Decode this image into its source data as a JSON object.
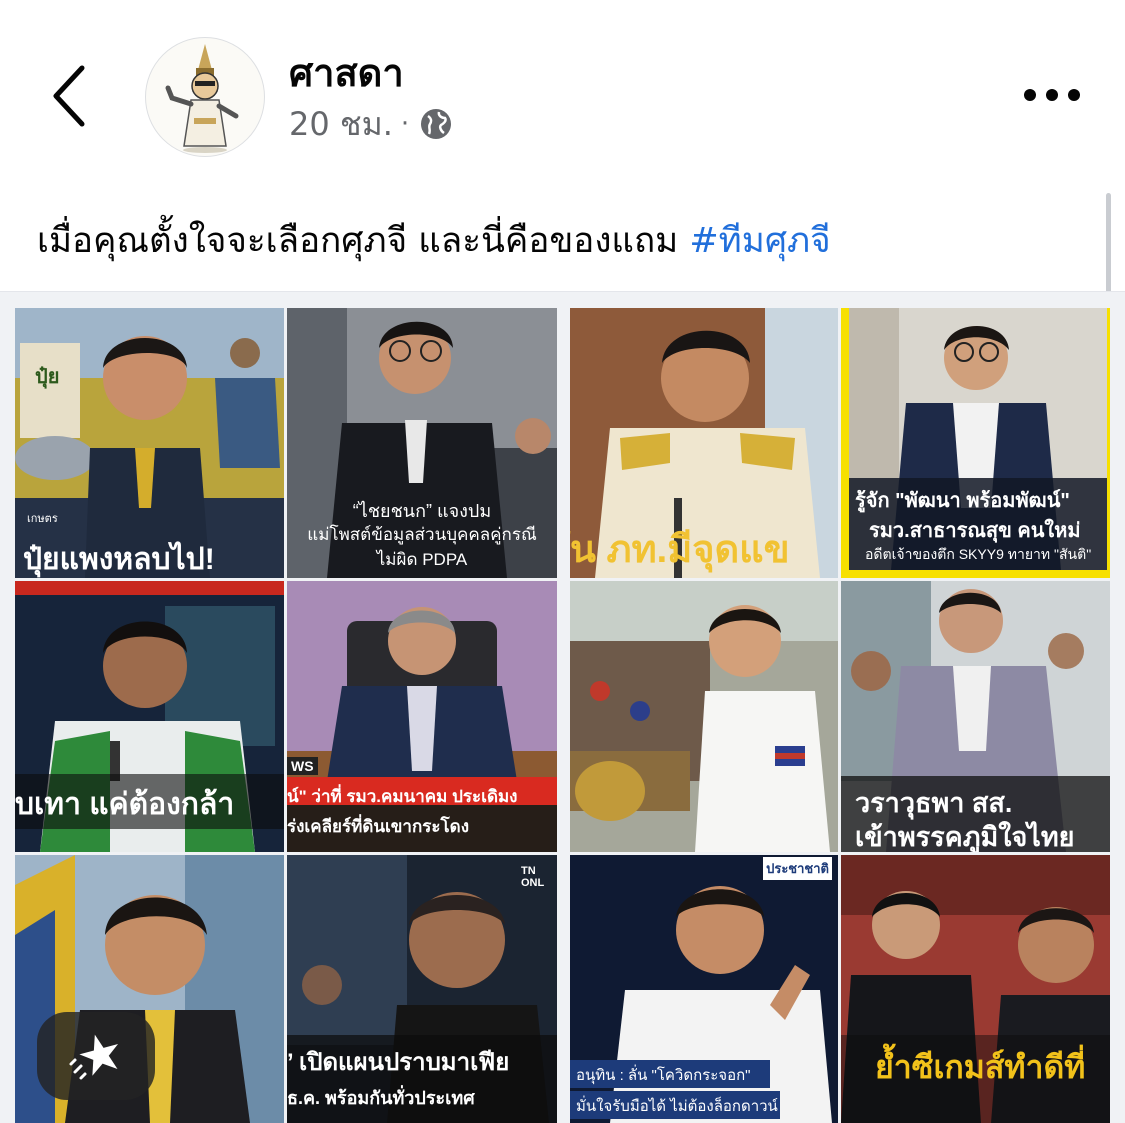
{
  "post": {
    "page_name": "ศาสดา",
    "time": "20 ชม.",
    "separator": "·",
    "privacy_icon": "globe-icon",
    "caption_text": "เมื่อคุณตั้งใจจะเลือกศุภจี และนี่คือของแถม ",
    "hashtag": "#ทีมศุภจี"
  },
  "icons": {
    "back": "chevron-left-icon",
    "more": "more-horizontal-icon",
    "sticker": "sparkle-icon"
  },
  "colors": {
    "hashtag": "#216fdb",
    "meta_text": "#65676b",
    "accent_red": "#e0291e",
    "accent_yellow": "#f7e000"
  },
  "tiles": [
    {
      "tag": "เกษตร",
      "headline": "ปุ๋ยแพงหลบไป!",
      "sack_text": "ปุ๋ย"
    },
    {
      "line1": "“ไชยชนก” แจงปม",
      "line2": "แม่โพสต์ข้อมูลส่วนบุคคลคู่กรณี",
      "line3": "ไม่ผิด PDPA"
    },
    {
      "headline": "ั่น ภท.มีจุดแข"
    },
    {
      "line1": "รู้จัก \"พัฒนา พร้อมพัฒน์\"",
      "line2": "รมว.สาธารณสุข คนใหม่",
      "line3": "อดีตเจ้าของตึก SKYY9 ทายาท \"สันติ\""
    },
    {
      "headline": "บเทา แค่ต้องกล้า"
    },
    {
      "tag": "WS",
      "line1": "น์\" ว่าที่ รมว.คมนาคม ประเดิมง",
      "line2": "ร่งเคลียร์ที่ดินเขากระโดง"
    },
    {},
    {
      "line1": "วราวุธพา สส.",
      "line2": "เข้าพรรคภูมิใจไทย"
    },
    {},
    {
      "tag": "TN ONL",
      "line1": "’ เปิดแผนปราบมาเฟีย",
      "line2": "ธ.ค. พร้อมกันทั่วประเทศ"
    },
    {
      "logo": "ประชาชาติ",
      "line1": "อนุทิน : ลั่น \"โควิดกระจอก\"",
      "line2": "มั่นใจรับมือได้ ไม่ต้องล็อกดาวน์"
    },
    {
      "headline": "ย้ำซีเกมส์ทำดีที่"
    }
  ]
}
